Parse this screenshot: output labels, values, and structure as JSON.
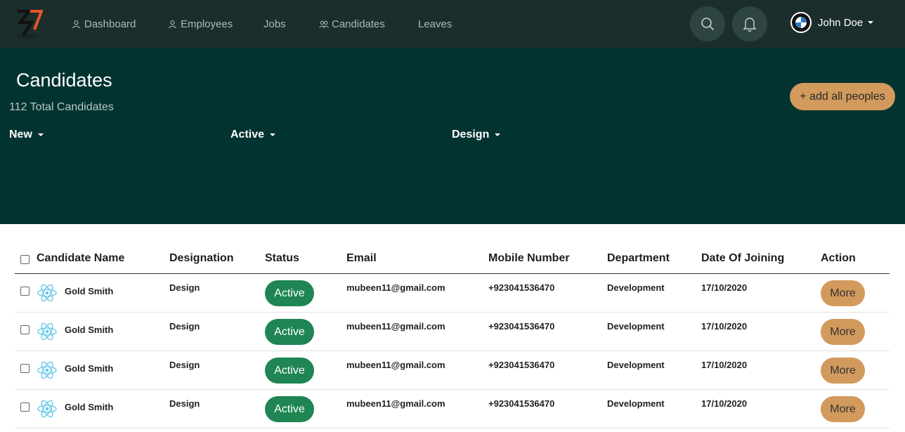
{
  "brand": {
    "logo_text": "DISTRICT"
  },
  "nav": {
    "items": [
      {
        "label": "Dashboard",
        "icon": "user-icon"
      },
      {
        "label": "Employees",
        "icon": "user-icon"
      },
      {
        "label": "Jobs",
        "icon": ""
      },
      {
        "label": "Candidates",
        "icon": "users-icon"
      },
      {
        "label": "Leaves",
        "icon": ""
      }
    ],
    "search_icon": "search-icon",
    "bell_icon": "bell-icon",
    "user_name": "John Doe"
  },
  "header": {
    "title": "Candidates",
    "subtitle": "112 Total Candidates",
    "add_button": "+ add all peoples",
    "filters": [
      "New",
      "Active",
      "Design"
    ]
  },
  "table": {
    "columns": [
      "Candidate Name",
      "Designation",
      "Status",
      "Email",
      "Mobile Number",
      "Department",
      "Date Of Joining",
      "Action"
    ],
    "rows": [
      {
        "name": "Gold Smith",
        "designation": "Design",
        "status": "Active",
        "email": "mubeen11@gmail.com",
        "mobile": "+923041536470",
        "department": "Development",
        "date": "17/10/2020",
        "action": "More"
      },
      {
        "name": "Gold Smith",
        "designation": "Design",
        "status": "Active",
        "email": "mubeen11@gmail.com",
        "mobile": "+923041536470",
        "department": "Development",
        "date": "17/10/2020",
        "action": "More"
      },
      {
        "name": "Gold Smith",
        "designation": "Design",
        "status": "Active",
        "email": "mubeen11@gmail.com",
        "mobile": "+923041536470",
        "department": "Development",
        "date": "17/10/2020",
        "action": "More"
      },
      {
        "name": "Gold Smith",
        "designation": "Design",
        "status": "Active",
        "email": "mubeen11@gmail.com",
        "mobile": "+923041536470",
        "department": "Development",
        "date": "17/10/2020",
        "action": "More"
      }
    ]
  },
  "colors": {
    "topbar": "#1b2e2c",
    "hero": "#023330",
    "accent": "#d29a5c",
    "status_active": "#1e8553"
  }
}
